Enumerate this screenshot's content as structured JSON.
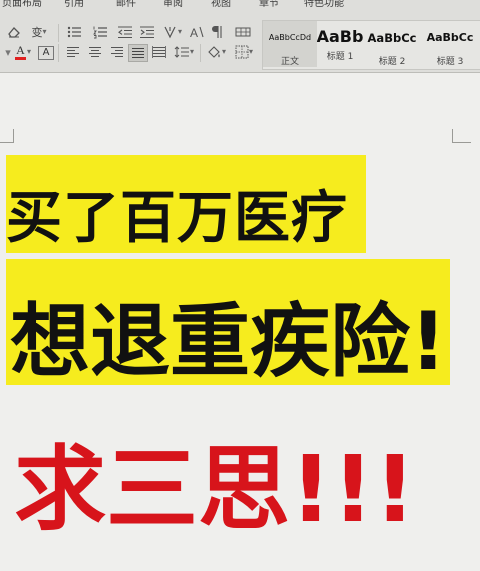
{
  "menu": {
    "page_layout": "页面布局",
    "references": "引用",
    "mailings": "邮件",
    "review": "审阅",
    "view": "视图",
    "sections": "章节",
    "features": "特色功能"
  },
  "toolbar": {
    "eraser_icon": "eraser-icon",
    "change_case_icon": "change-case-icon",
    "bullets_icon": "bullet-list-icon",
    "numbering_icon": "numbered-list-icon",
    "decrease_indent_icon": "decrease-indent-icon",
    "increase_indent_icon": "increase-indent-icon",
    "chinese_layout_icon": "chinese-layout-icon",
    "text_direction_icon": "text-direction-icon",
    "show_marks_icon": "show-marks-icon",
    "font_color_glyph": "A",
    "char_border_glyph": "A"
  },
  "styles": {
    "items": [
      {
        "sample": "AaBbCcDd",
        "name": "正文"
      },
      {
        "sample": "AaBb",
        "name": "标题 1"
      },
      {
        "sample": "AaBbCc",
        "name": "标题 2"
      },
      {
        "sample": "AaBbCc",
        "name": "标题 3"
      }
    ]
  },
  "document": {
    "line1": "买了百万医疗",
    "line2": "想退重疾险!",
    "line3": "求三思!!!",
    "highlight_color": "#f6ec1e",
    "red_color": "#d7141b"
  }
}
